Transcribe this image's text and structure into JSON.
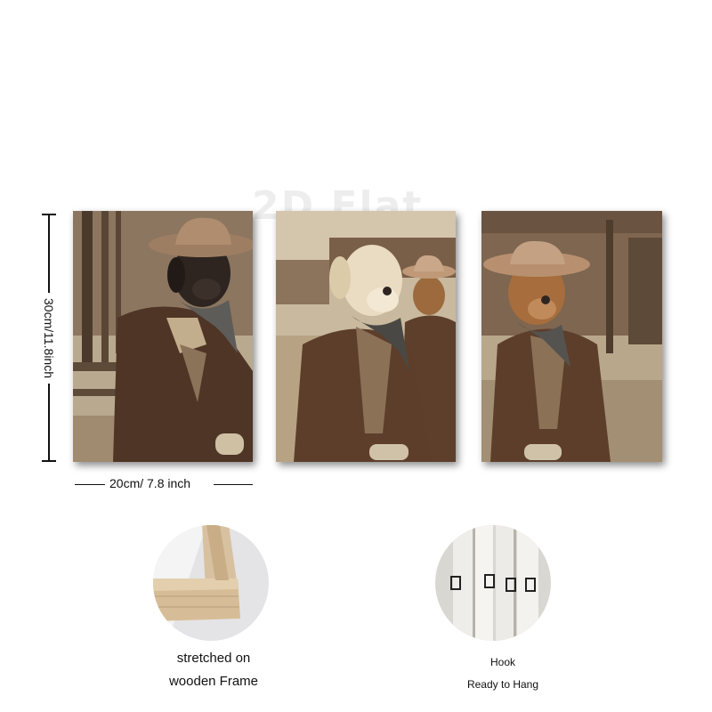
{
  "watermark": "2D Flat",
  "dimensions": {
    "height_label": "30cm/11.8inch",
    "width_label": "20cm/ 7.8 inch"
  },
  "features": [
    {
      "icon": "wooden-frame-icon",
      "line1": "stretched on",
      "line2": "wooden Frame"
    },
    {
      "icon": "hook-icon",
      "line1": "Hook",
      "line2": "Ready to Hang"
    }
  ],
  "colors": {
    "sepia_light": "#c9b79c",
    "coat_brown": "#5a3d2b",
    "hat_tan": "#b89070"
  }
}
